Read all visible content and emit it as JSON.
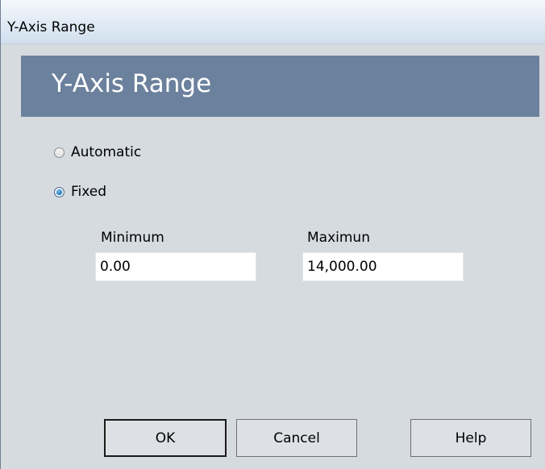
{
  "window": {
    "title": "Y-Axis Range"
  },
  "banner": {
    "heading": "Y-Axis Range"
  },
  "range_mode": {
    "options": [
      {
        "label": "Automatic",
        "checked": false
      },
      {
        "label": "Fixed",
        "checked": true
      }
    ]
  },
  "fields": {
    "minimum": {
      "label": "Minimum",
      "value": "0.00"
    },
    "maximum": {
      "label": "Maximun",
      "value": "14,000.00"
    }
  },
  "buttons": {
    "ok": "OK",
    "cancel": "Cancel",
    "help": "Help"
  },
  "colors": {
    "banner": "#6b819d",
    "dialog_background": "#d6dbe0",
    "radio_selected": "#2a7fc2"
  }
}
